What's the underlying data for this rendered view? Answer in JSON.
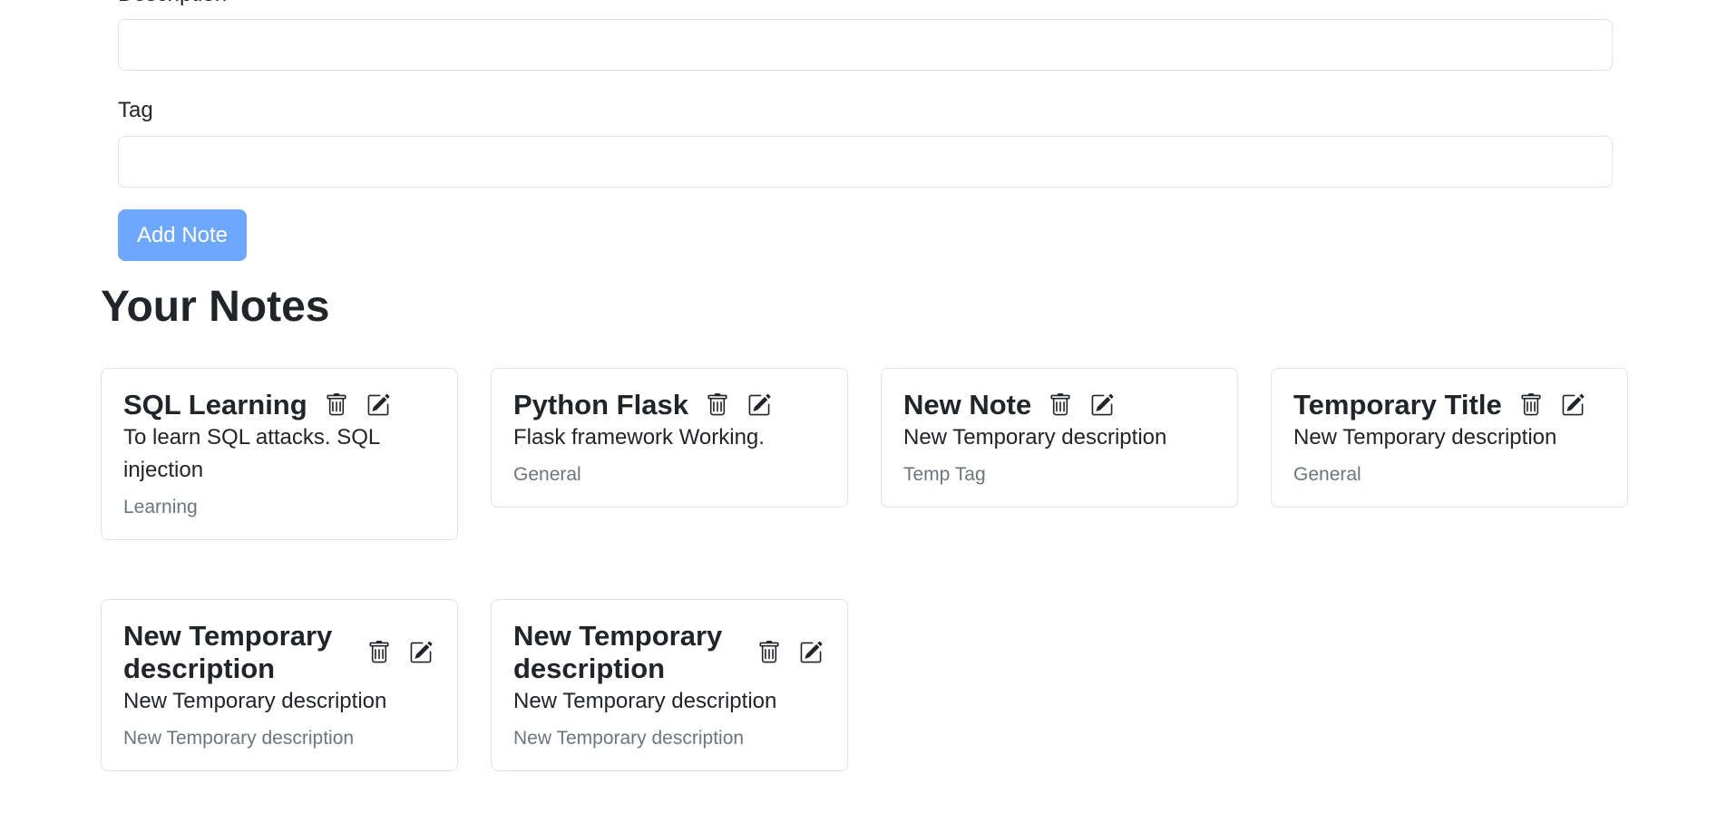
{
  "form": {
    "description_label": "Description",
    "description_value": "",
    "tag_label": "Tag",
    "tag_value": "",
    "submit_label": "Add Note"
  },
  "notes_section": {
    "title": "Your Notes"
  },
  "notes": [
    {
      "title": "SQL Learning",
      "description": "To learn SQL attacks. SQL injection",
      "tag": "Learning"
    },
    {
      "title": "Python Flask",
      "description": "Flask framework Working.",
      "tag": "General"
    },
    {
      "title": "New Note",
      "description": "New Temporary description",
      "tag": "Temp Tag"
    },
    {
      "title": "Temporary Title",
      "description": "New Temporary description",
      "tag": "General"
    },
    {
      "title": "New Temporary description",
      "description": "New Temporary description",
      "tag": "New Temporary description"
    },
    {
      "title": "New Temporary description",
      "description": "New Temporary description",
      "tag": "New Temporary description"
    }
  ],
  "icons": {
    "delete": "trash-icon",
    "edit": "pencil-square-icon"
  },
  "colors": {
    "primary_button": "#6ea8fe",
    "muted_text": "#6c757d",
    "border": "#dee2e6"
  }
}
